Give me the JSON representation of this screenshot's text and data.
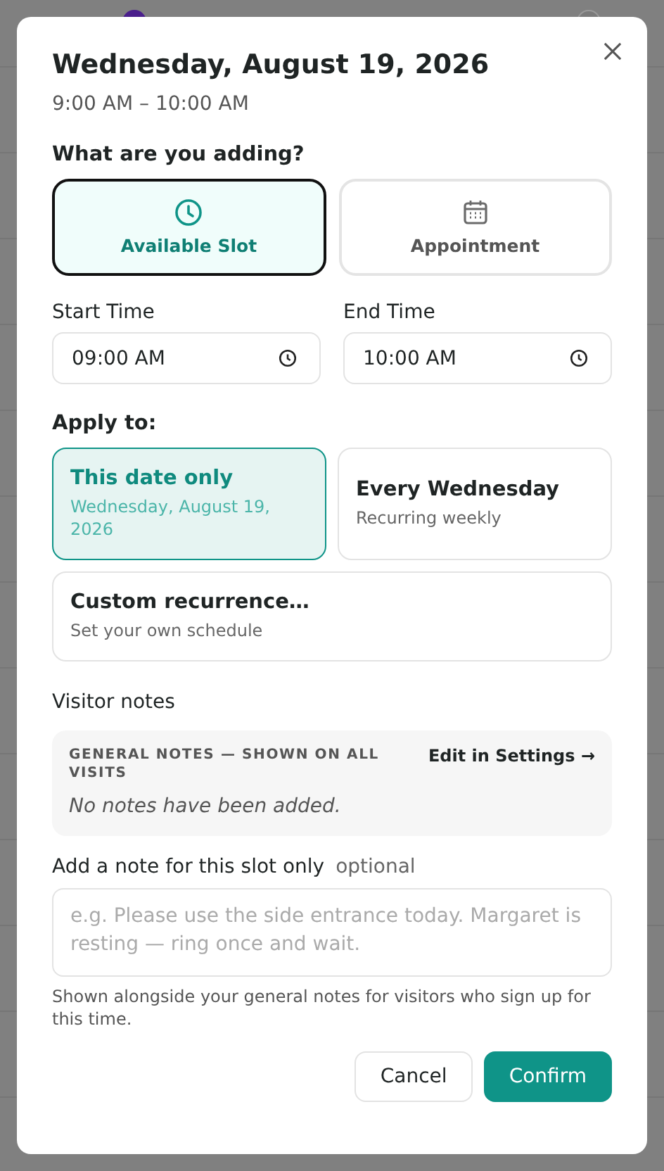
{
  "dialog": {
    "title": "Wednesday, August 19, 2026",
    "subtitle": "9:00 AM – 10:00 AM",
    "type_section": {
      "label": "What are you adding?",
      "options": [
        {
          "kind": "slot",
          "label": "Available Slot",
          "selected": true
        },
        {
          "kind": "appointment",
          "label": "Appointment",
          "selected": false
        }
      ]
    },
    "start_time": {
      "label": "Start Time",
      "value": "09:00 AM"
    },
    "end_time": {
      "label": "End Time",
      "value": "10:00 AM"
    },
    "apply_section": {
      "label": "Apply to:",
      "options": [
        {
          "title": "This date only",
          "subtitle": "Wednesday, August 19, 2026",
          "selected": true
        },
        {
          "title": "Every Wednesday",
          "subtitle": "Recurring weekly",
          "selected": false
        },
        {
          "title": "Custom recurrence…",
          "subtitle": "Set your own schedule",
          "selected": false
        }
      ]
    },
    "visitor_notes": {
      "label": "Visitor notes",
      "general_heading": "GENERAL NOTES — SHOWN ON ALL VISITS",
      "edit_link": "Edit in Settings",
      "edit_arrow": "→",
      "empty_text": "No notes have been added."
    },
    "slot_note": {
      "label": "Add a note for this slot only",
      "optional": "optional",
      "placeholder": "e.g. Please use the side entrance today. Margaret is resting — ring once and wait.",
      "help": "Shown alongside your general notes for visitors who sign up for this time."
    },
    "buttons": [
      {
        "kind": "secondary",
        "label": "Cancel"
      },
      {
        "kind": "primary",
        "label": "Confirm"
      }
    ]
  }
}
